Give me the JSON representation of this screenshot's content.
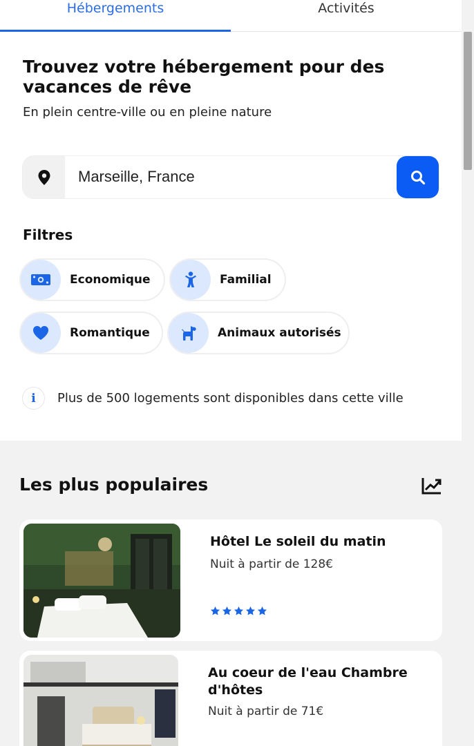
{
  "tabs": [
    {
      "label": "Hébergements",
      "active": true
    },
    {
      "label": "Activités",
      "active": false
    }
  ],
  "hero": {
    "title": "Trouvez votre hébergement pour des vacances de rêve",
    "subtitle": "En plein centre-ville ou en pleine nature"
  },
  "search": {
    "value": "Marseille, France",
    "location_icon": "map-pin-icon",
    "button_icon": "search-icon"
  },
  "filters": {
    "title": "Filtres",
    "items": [
      {
        "label": "Economique",
        "icon": "banknote-icon"
      },
      {
        "label": "Familial",
        "icon": "child-icon"
      },
      {
        "label": "Romantique",
        "icon": "heart-icon"
      },
      {
        "label": "Animaux autorisés",
        "icon": "dog-icon"
      }
    ]
  },
  "info": {
    "text": "Plus de 500 logements sont disponibles dans cette ville"
  },
  "popular": {
    "title": "Les plus populaires",
    "trend_icon": "chart-line-icon",
    "cards": [
      {
        "name": "Hôtel Le soleil du matin",
        "price": "Nuit à partir de 128€",
        "rating": 5
      },
      {
        "name": "Au coeur de l'eau Chambre d'hôtes",
        "price": "Nuit à partir de 71€"
      }
    ]
  },
  "colors": {
    "accent": "#0a5cf5",
    "tab_active": "#2b6de0",
    "chip_icon_bg": "#dce8fd",
    "page_bg": "#f2f2f2"
  }
}
